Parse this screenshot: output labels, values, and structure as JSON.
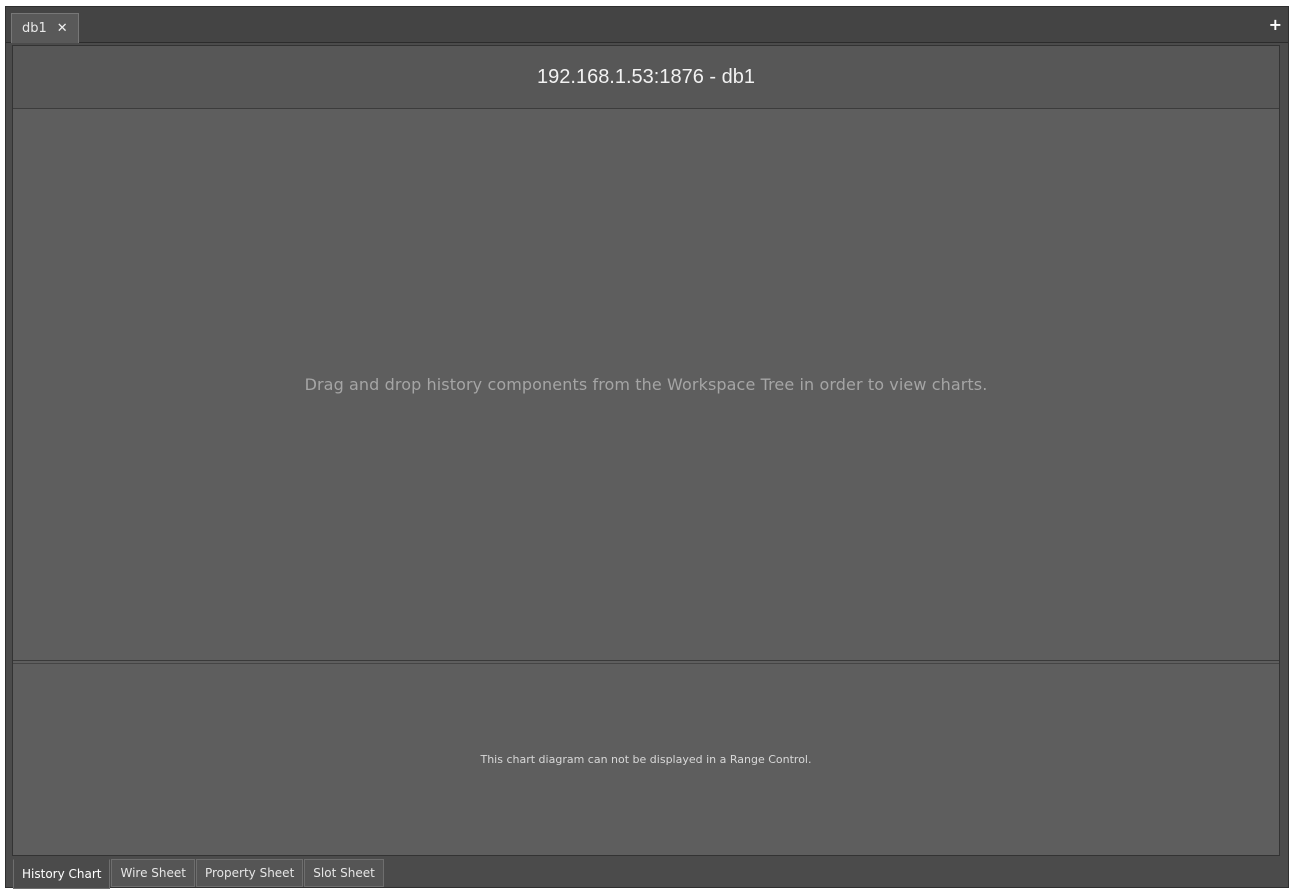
{
  "document_tabs": [
    {
      "label": "db1",
      "close_icon": "close-icon"
    }
  ],
  "add_tab_icon": "plus-icon",
  "view": {
    "title": "192.168.1.53:1876 - db1",
    "chart_placeholder": "Drag and drop history components from the Workspace Tree in order to view charts.",
    "range_control_message": "This chart diagram can not be displayed in a Range Control."
  },
  "view_tabs": [
    {
      "label": "History Chart",
      "active": true
    },
    {
      "label": "Wire Sheet",
      "active": false
    },
    {
      "label": "Property Sheet",
      "active": false
    },
    {
      "label": "Slot Sheet",
      "active": false
    }
  ],
  "colors": {
    "background": "#5e5e5e",
    "frame": "#4b4b4b",
    "text": "#f2f2f2"
  }
}
